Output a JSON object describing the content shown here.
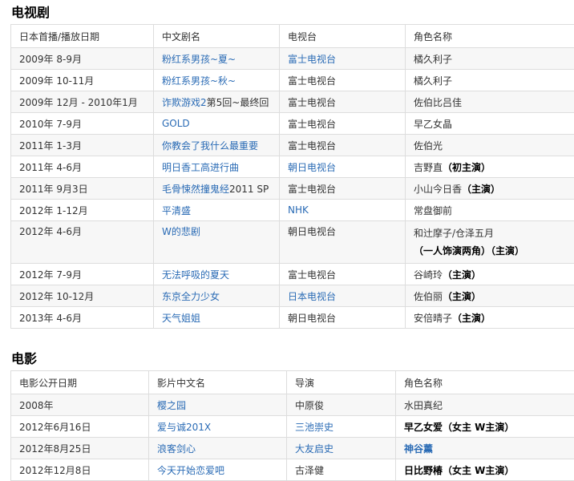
{
  "tv": {
    "heading": "电视剧",
    "headers": [
      "日本首播/播放日期",
      "中文剧名",
      "电视台",
      "角色名称"
    ],
    "rows": [
      {
        "date": "2009年 8-9月",
        "title": "粉红系男孩~夏~",
        "station": "富士电视台",
        "role": "橘久利子"
      },
      {
        "date": "2009年 10-11月",
        "title": "粉红系男孩~秋~",
        "station": "富士电视台",
        "role": "橘久利子"
      },
      {
        "date": "2009年 12月 - 2010年1月",
        "title_link": "诈欺游戏2",
        "title_rest": "第5回~最终回",
        "station": "富士电视台",
        "role": "佐伯比吕佳"
      },
      {
        "date": "2010年 7-9月",
        "title": "GOLD",
        "station": "富士电视台",
        "role": "早乙女晶"
      },
      {
        "date": "2011年 1-3月",
        "title": "你教会了我什么最重要",
        "station": "富士电视台",
        "role": "佐伯光"
      },
      {
        "date": "2011年 4-6月",
        "title": "明日香工高进行曲",
        "station": "朝日电视台",
        "role_name": "吉野直",
        "role_note": "（初主演）"
      },
      {
        "date": "2011年 9月3日",
        "title_link": "毛骨悚然撞鬼经",
        "title_rest": "2011 SP",
        "station": "富士电视台",
        "role_name": "小山今日香",
        "role_note": "（主演）"
      },
      {
        "date": "2012年 1-12月",
        "title": "平清盛",
        "station": "NHK",
        "role": "常盘御前"
      },
      {
        "date": "2012年 4-6月",
        "title": "W的悲剧",
        "station": "朝日电视台",
        "role_line1": "和辻摩子/仓泽五月",
        "role_line2": "（一人饰演两角）（主演）"
      },
      {
        "date": "2012年 7-9月",
        "title": "无法呼吸的夏天",
        "station": "富士电视台",
        "role_name": "谷崎玲",
        "role_note": "（主演）"
      },
      {
        "date": "2012年 10-12月",
        "title": "东京全力少女",
        "station": "日本电视台",
        "role_name": "佐伯丽",
        "role_note": "（主演）"
      },
      {
        "date": "2013年 4-6月",
        "title": "天气姐姐",
        "station": "朝日电视台",
        "role_name": "安倍晴子",
        "role_note": "（主演）"
      }
    ]
  },
  "movie": {
    "heading": "电影",
    "headers": [
      "电影公开日期",
      "影片中文名",
      "导演",
      "角色名称"
    ],
    "rows": [
      {
        "date": "2008年",
        "title": "樱之园",
        "director": "中原俊",
        "role": "水田真纪"
      },
      {
        "date": "2012年6月16日",
        "title": "爱与诚201X",
        "director": "三池崇史",
        "role": "早乙女爱（女主 W主演）"
      },
      {
        "date": "2012年8月25日",
        "title": "浪客剑心",
        "director": "大友启史",
        "role": "神谷薰"
      },
      {
        "date": "2012年12月8日",
        "title": "今天开始恋爱吧",
        "director": "古泽健",
        "role": "日比野椿（女主 W主演）"
      }
    ]
  },
  "colors": {
    "link": "#2a6bb5",
    "border": "#dddddd",
    "stripe": "#f7f7f7"
  }
}
